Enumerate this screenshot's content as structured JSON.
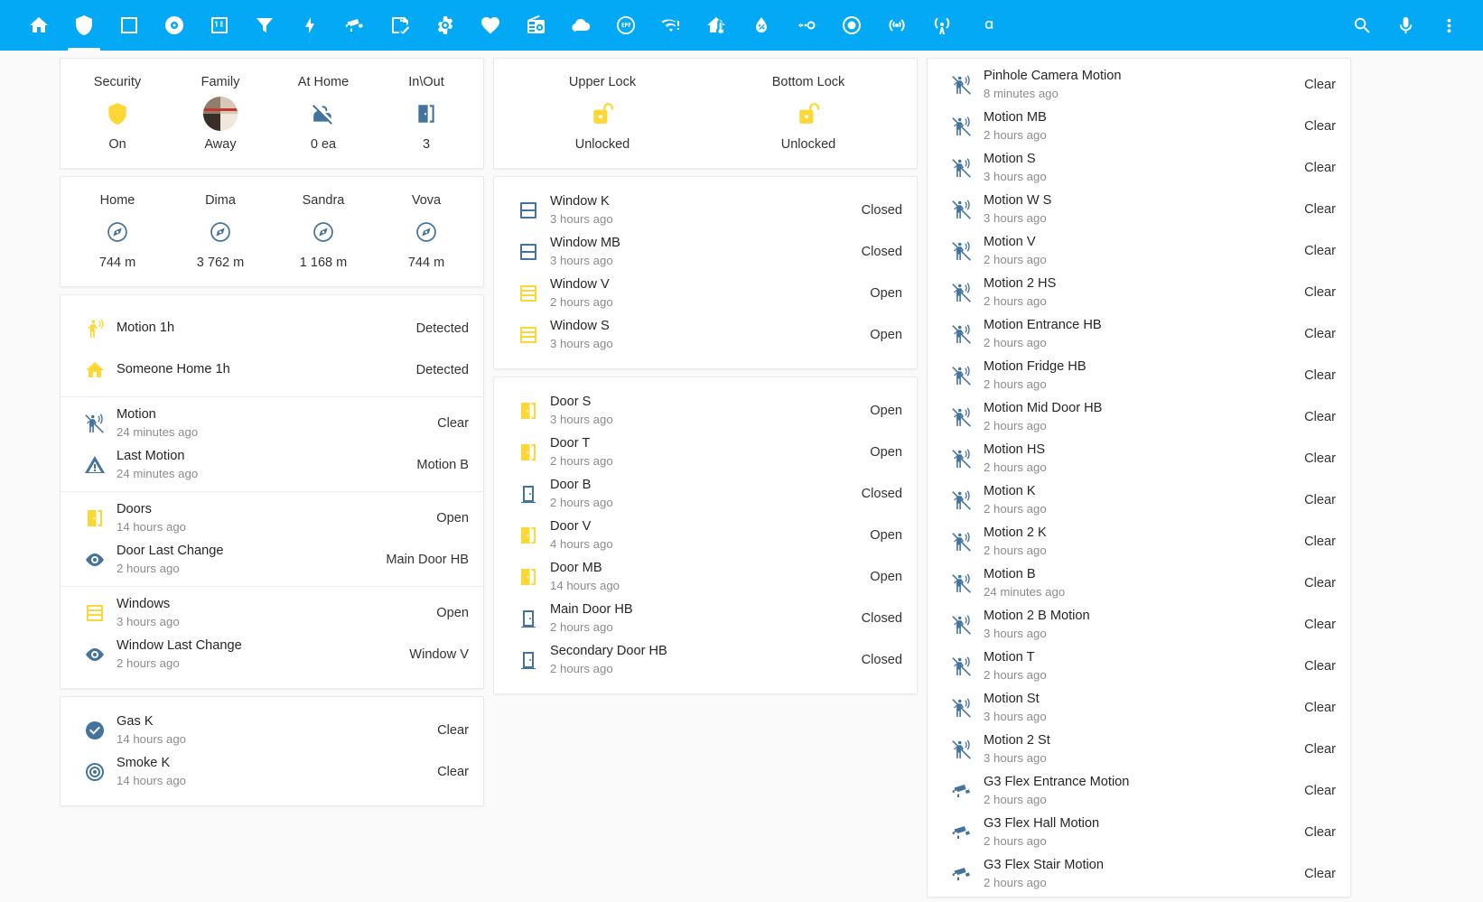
{
  "toolbar": {
    "tabs": [
      {
        "name": "home",
        "icon": "home-icon",
        "active": false
      },
      {
        "name": "security",
        "icon": "shield-icon",
        "active": true
      },
      {
        "name": "rooms",
        "icon": "square-outline-icon",
        "active": false
      },
      {
        "name": "media",
        "icon": "disc-icon",
        "active": false
      },
      {
        "name": "meters",
        "icon": "counter-icon",
        "active": false
      },
      {
        "name": "climate-filter",
        "icon": "funnel-icon",
        "active": false
      },
      {
        "name": "energy",
        "icon": "lightning-bolt-icon",
        "active": false
      },
      {
        "name": "cameras",
        "icon": "cctv-icon",
        "active": false
      },
      {
        "name": "notes",
        "icon": "note-edit-icon",
        "active": false
      },
      {
        "name": "settings",
        "icon": "gear-icon",
        "active": false
      },
      {
        "name": "health",
        "icon": "heart-pulse-icon",
        "active": false
      },
      {
        "name": "radio",
        "icon": "radio-icon",
        "active": false
      },
      {
        "name": "weather",
        "icon": "cloud-icon",
        "active": false
      },
      {
        "name": "esphome",
        "icon": "esp-icon",
        "active": false
      },
      {
        "name": "network",
        "icon": "wifi-alert-icon",
        "active": false
      },
      {
        "name": "home-thermometer",
        "icon": "home-thermometer-icon",
        "active": false
      },
      {
        "name": "humidity",
        "icon": "water-percent-icon",
        "active": false
      },
      {
        "name": "switches",
        "icon": "toggle-switch-icon",
        "active": false
      },
      {
        "name": "presence",
        "icon": "record-circle-icon",
        "active": false
      },
      {
        "name": "broadcast",
        "icon": "broadcast-icon",
        "active": false
      },
      {
        "name": "antenna",
        "icon": "antenna-icon",
        "active": false
      },
      {
        "name": "alpha",
        "icon": "alpha-icon",
        "active": false
      }
    ],
    "actions": [
      {
        "name": "search",
        "icon": "search-icon"
      },
      {
        "name": "assist",
        "icon": "microphone-icon"
      },
      {
        "name": "overflow-menu",
        "icon": "dots-vertical-icon"
      }
    ]
  },
  "left_column": {
    "status_glance": [
      {
        "name": "Security",
        "icon": "shield-icon",
        "color": "#fdd835",
        "state": "On"
      },
      {
        "name": "Family",
        "icon": "avatar-group",
        "color": "",
        "state": "Away"
      },
      {
        "name": "At Home",
        "icon": "account-off-icon",
        "color": "#44739e",
        "state": "0 ea"
      },
      {
        "name": "In\\Out",
        "icon": "door-open-icon",
        "color": "#44739e",
        "state": "3"
      }
    ],
    "distance_glance": [
      {
        "name": "Home",
        "icon": "compass-icon",
        "color": "#44739e",
        "state": "744 m"
      },
      {
        "name": "Dima",
        "icon": "compass-icon",
        "color": "#44739e",
        "state": "3 762 m"
      },
      {
        "name": "Sandra",
        "icon": "compass-icon",
        "color": "#44739e",
        "state": "1 168 m"
      },
      {
        "name": "Vova",
        "icon": "compass-icon",
        "color": "#44739e",
        "state": "744 m"
      }
    ],
    "summary_groups": [
      [
        {
          "name": "Motion 1h",
          "sub": "",
          "state": "Detected",
          "icon": "motion-sensor-icon",
          "color": "#fdd835"
        },
        {
          "name": "Someone Home 1h",
          "sub": "",
          "state": "Detected",
          "icon": "home-icon",
          "color": "#fdd835"
        }
      ],
      [
        {
          "name": "Motion",
          "sub": "24 minutes ago",
          "state": "Clear",
          "icon": "motion-sensor-off-icon",
          "color": "#44739e"
        },
        {
          "name": "Last Motion",
          "sub": "24 minutes ago",
          "state": "Motion B",
          "icon": "alert-icon",
          "color": "#44739e"
        }
      ],
      [
        {
          "name": "Doors",
          "sub": "14 hours ago",
          "state": "Open",
          "icon": "door-open-icon",
          "color": "#fdd835"
        },
        {
          "name": "Door Last Change",
          "sub": "2 hours ago",
          "state": "Main Door HB",
          "icon": "eye-icon",
          "color": "#44739e"
        }
      ],
      [
        {
          "name": "Windows",
          "sub": "3 hours ago",
          "state": "Open",
          "icon": "window-open-icon",
          "color": "#fdd835"
        },
        {
          "name": "Window Last Change",
          "sub": "2 hours ago",
          "state": "Window V",
          "icon": "eye-icon",
          "color": "#44739e"
        }
      ]
    ],
    "safety_group": [
      {
        "name": "Gas K",
        "sub": "14 hours ago",
        "state": "Clear",
        "icon": "check-circle-icon",
        "color": "#44739e"
      },
      {
        "name": "Smoke K",
        "sub": "14 hours ago",
        "state": "Clear",
        "icon": "smoke-detector-icon",
        "color": "#44739e"
      }
    ]
  },
  "middle_column": {
    "locks_glance": [
      {
        "name": "Upper Lock",
        "icon": "lock-open-icon",
        "color": "#fdd835",
        "state": "Unlocked"
      },
      {
        "name": "Bottom Lock",
        "icon": "lock-open-icon",
        "color": "#fdd835",
        "state": "Unlocked"
      }
    ],
    "windows": [
      {
        "name": "Window K",
        "sub": "3 hours ago",
        "state": "Closed",
        "icon": "window-closed-icon",
        "color": "#44739e"
      },
      {
        "name": "Window MB",
        "sub": "3 hours ago",
        "state": "Closed",
        "icon": "window-closed-icon",
        "color": "#44739e"
      },
      {
        "name": "Window V",
        "sub": "2 hours ago",
        "state": "Open",
        "icon": "window-open-icon",
        "color": "#fdd835"
      },
      {
        "name": "Window S",
        "sub": "3 hours ago",
        "state": "Open",
        "icon": "window-open-icon",
        "color": "#fdd835"
      }
    ],
    "doors": [
      {
        "name": "Door S",
        "sub": "3 hours ago",
        "state": "Open",
        "icon": "door-open-icon",
        "color": "#fdd835"
      },
      {
        "name": "Door T",
        "sub": "2 hours ago",
        "state": "Open",
        "icon": "door-open-icon",
        "color": "#fdd835"
      },
      {
        "name": "Door B",
        "sub": "2 hours ago",
        "state": "Closed",
        "icon": "door-closed-icon",
        "color": "#44739e"
      },
      {
        "name": "Door V",
        "sub": "4 hours ago",
        "state": "Open",
        "icon": "door-open-icon",
        "color": "#fdd835"
      },
      {
        "name": "Door MB",
        "sub": "14 hours ago",
        "state": "Open",
        "icon": "door-open-icon",
        "color": "#fdd835"
      },
      {
        "name": "Main Door HB",
        "sub": "2 hours ago",
        "state": "Closed",
        "icon": "door-closed-icon",
        "color": "#44739e"
      },
      {
        "name": "Secondary Door HB",
        "sub": "2 hours ago",
        "state": "Closed",
        "icon": "door-closed-icon",
        "color": "#44739e"
      }
    ]
  },
  "right_column": {
    "motion_sensors": [
      {
        "name": "Pinhole Camera Motion",
        "sub": "8 minutes ago",
        "state": "Clear",
        "icon": "motion-sensor-off-icon"
      },
      {
        "name": "Motion MB",
        "sub": "2 hours ago",
        "state": "Clear",
        "icon": "motion-sensor-off-icon"
      },
      {
        "name": "Motion S",
        "sub": "3 hours ago",
        "state": "Clear",
        "icon": "motion-sensor-off-icon"
      },
      {
        "name": "Motion W S",
        "sub": "3 hours ago",
        "state": "Clear",
        "icon": "motion-sensor-off-icon"
      },
      {
        "name": "Motion V",
        "sub": "2 hours ago",
        "state": "Clear",
        "icon": "motion-sensor-off-icon"
      },
      {
        "name": "Motion 2 HS",
        "sub": "2 hours ago",
        "state": "Clear",
        "icon": "motion-sensor-off-icon"
      },
      {
        "name": "Motion Entrance HB",
        "sub": "2 hours ago",
        "state": "Clear",
        "icon": "motion-sensor-off-icon"
      },
      {
        "name": "Motion Fridge HB",
        "sub": "2 hours ago",
        "state": "Clear",
        "icon": "motion-sensor-off-icon"
      },
      {
        "name": "Motion Mid Door HB",
        "sub": "2 hours ago",
        "state": "Clear",
        "icon": "motion-sensor-off-icon"
      },
      {
        "name": "Motion HS",
        "sub": "2 hours ago",
        "state": "Clear",
        "icon": "motion-sensor-off-icon"
      },
      {
        "name": "Motion K",
        "sub": "2 hours ago",
        "state": "Clear",
        "icon": "motion-sensor-off-icon"
      },
      {
        "name": "Motion 2 K",
        "sub": "2 hours ago",
        "state": "Clear",
        "icon": "motion-sensor-off-icon"
      },
      {
        "name": "Motion B",
        "sub": "24 minutes ago",
        "state": "Clear",
        "icon": "motion-sensor-off-icon"
      },
      {
        "name": "Motion 2 B Motion",
        "sub": "3 hours ago",
        "state": "Clear",
        "icon": "motion-sensor-off-icon"
      },
      {
        "name": "Motion T",
        "sub": "2 hours ago",
        "state": "Clear",
        "icon": "motion-sensor-off-icon"
      },
      {
        "name": "Motion St",
        "sub": "3 hours ago",
        "state": "Clear",
        "icon": "motion-sensor-off-icon"
      },
      {
        "name": "Motion 2 St",
        "sub": "3 hours ago",
        "state": "Clear",
        "icon": "motion-sensor-off-icon"
      },
      {
        "name": "G3 Flex Entrance Motion",
        "sub": "2 hours ago",
        "state": "Clear",
        "icon": "cctv-icon"
      },
      {
        "name": "G3 Flex Hall Motion",
        "sub": "2 hours ago",
        "state": "Clear",
        "icon": "cctv-icon"
      },
      {
        "name": "G3 Flex Stair Motion",
        "sub": "2 hours ago",
        "state": "Clear",
        "icon": "cctv-icon"
      }
    ]
  },
  "colors": {
    "accent": "#03a9f4",
    "amber": "#fdd835",
    "blue": "#44739e",
    "background": "#fafafa",
    "card": "#ffffff"
  }
}
